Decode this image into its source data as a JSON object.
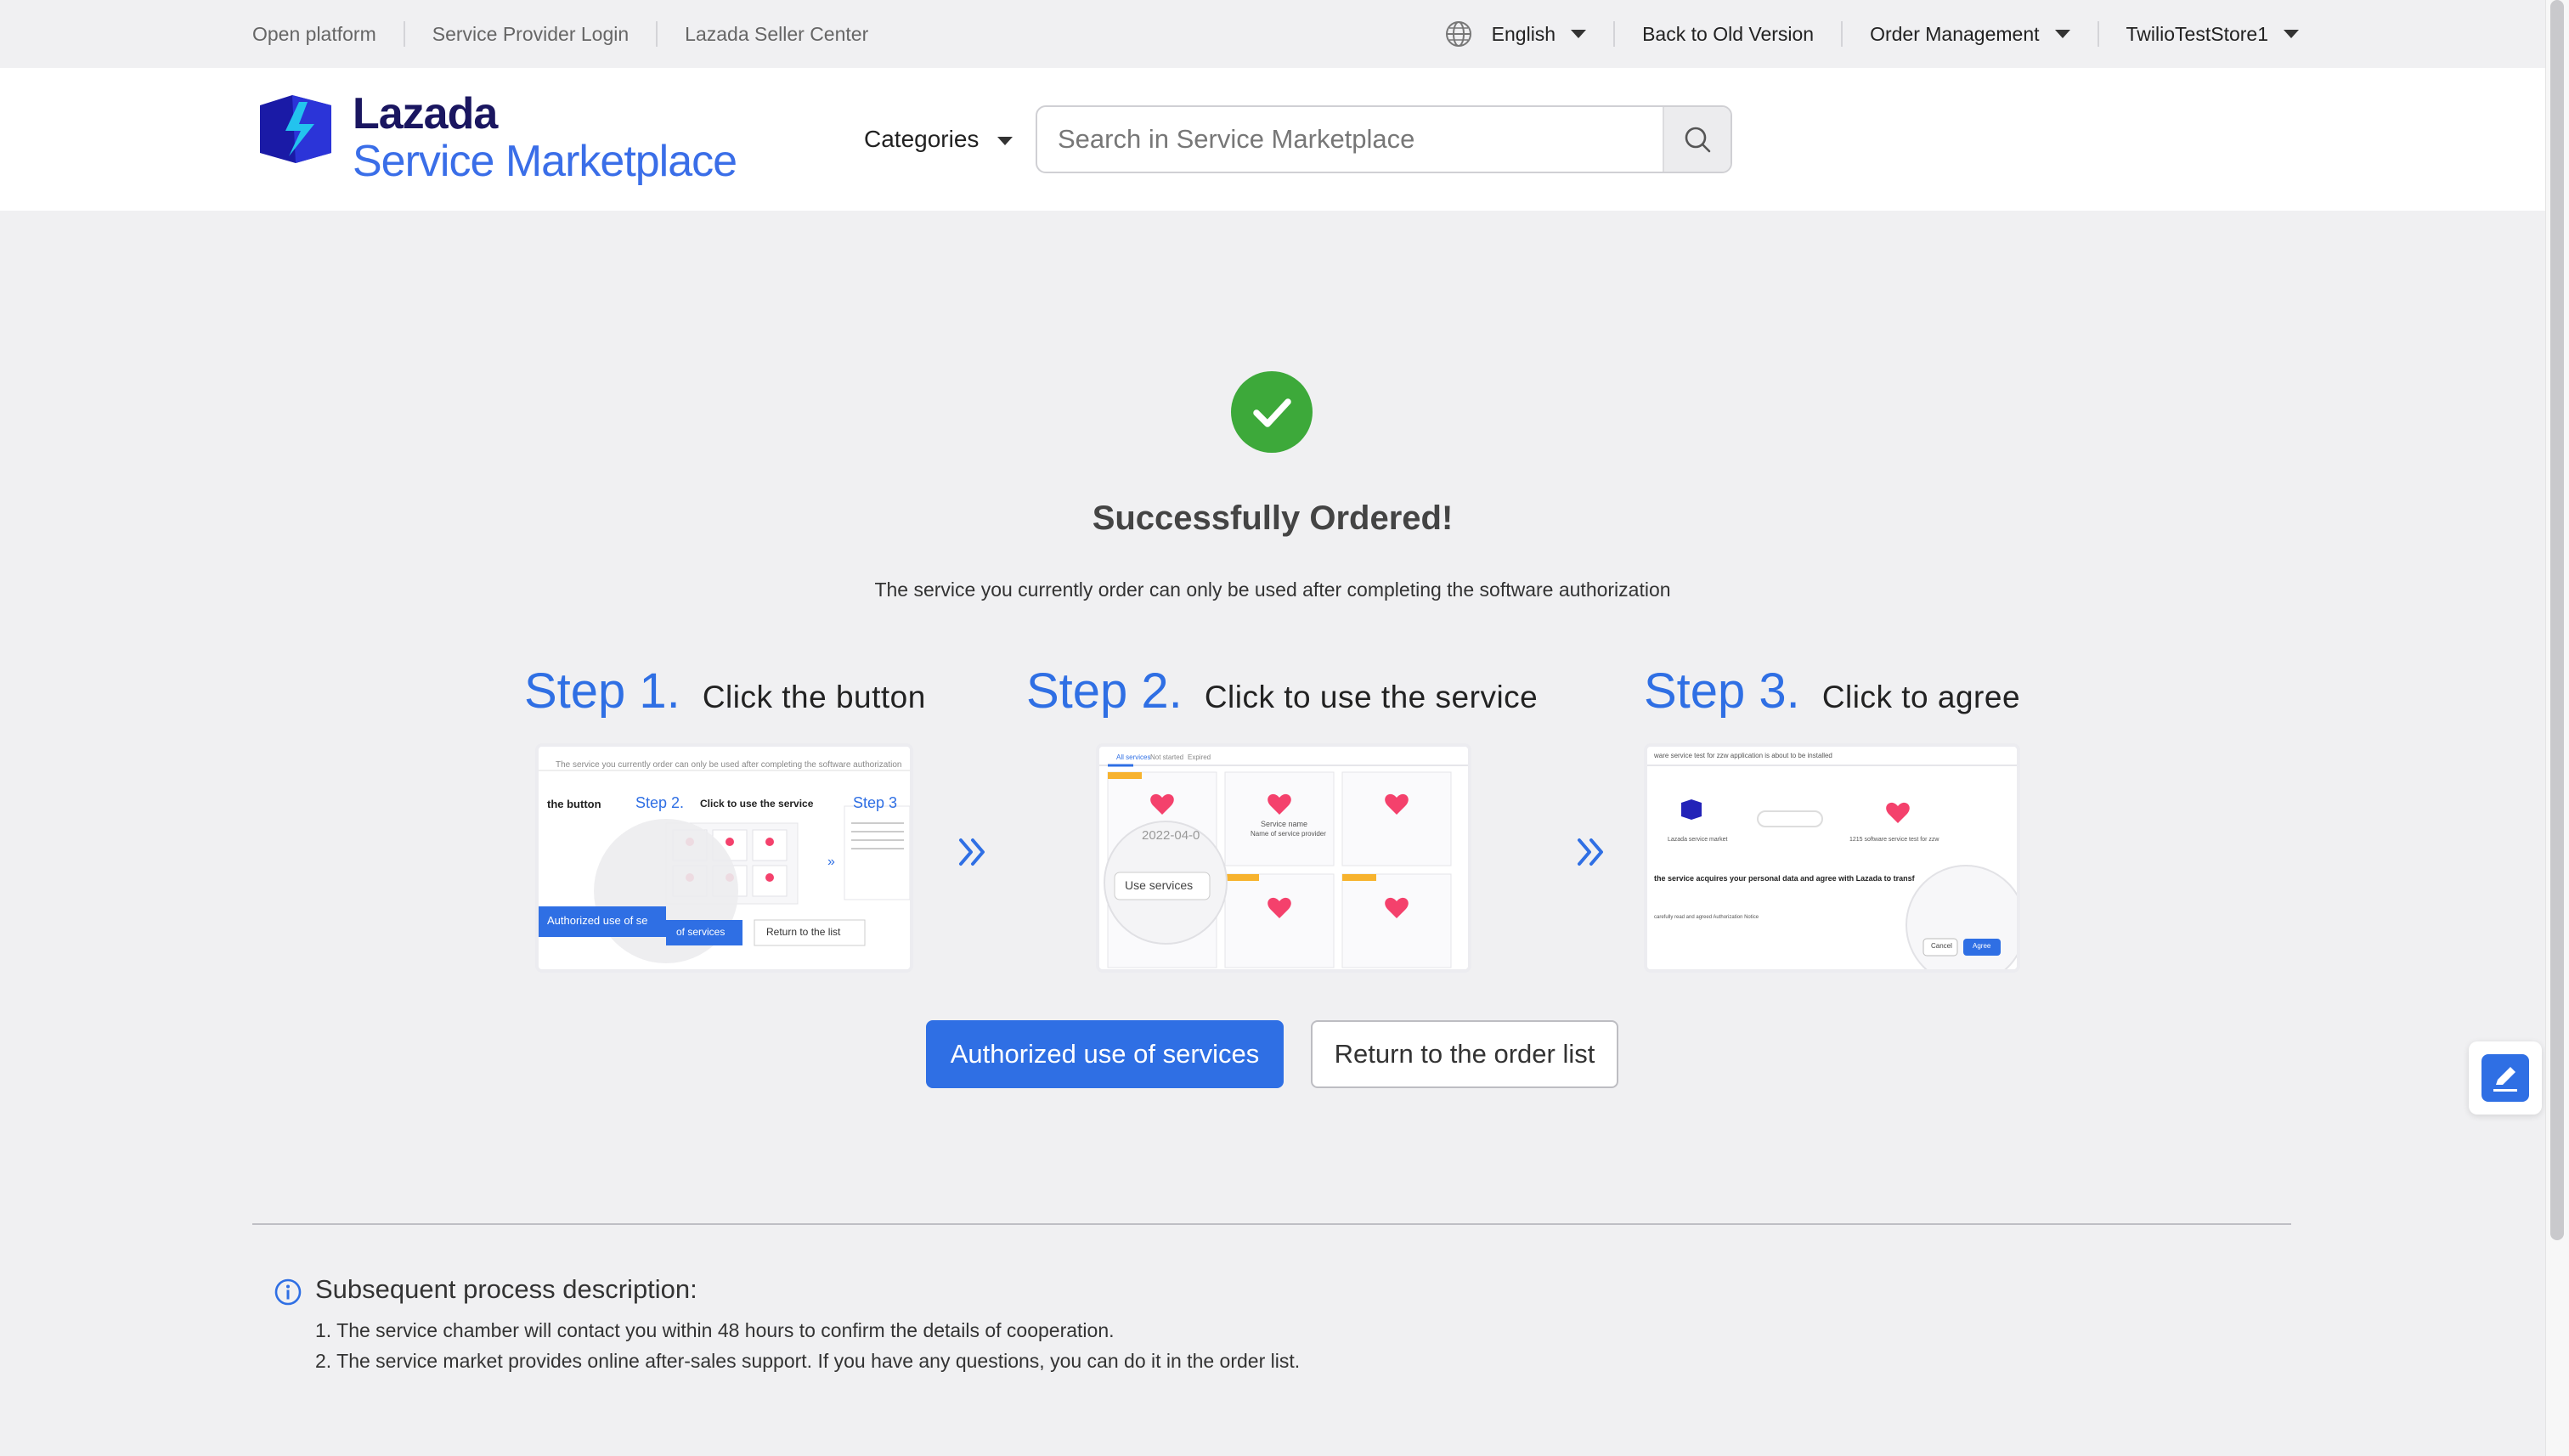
{
  "topbar": {
    "left_links": [
      "Open platform",
      "Service Provider Login",
      "Lazada Seller Center"
    ],
    "language": "English",
    "back_old": "Back to Old Version",
    "order_management": "Order Management",
    "account": "TwilioTestStore1"
  },
  "header": {
    "logo_line1": "Lazada",
    "logo_line2": "Service Marketplace",
    "categories": "Categories",
    "search_placeholder": "Search in Service Marketplace"
  },
  "main": {
    "title": "Successfully Ordered!",
    "subtitle": "The service you currently order can only be used after completing the software authorization",
    "steps": [
      {
        "num": "Step 1.",
        "desc": "Click the button"
      },
      {
        "num": "Step 2.",
        "desc": "Click to use the service"
      },
      {
        "num": "Step 3.",
        "desc": "Click to agree"
      }
    ],
    "shots": {
      "s1_top": "The service you currently order can only be used after completing the software authorization",
      "s1_button": "the button",
      "s1_step2": "Step 2.",
      "s1_step2_desc": "Click to use the service",
      "s1_step3": "Step 3",
      "s1_auth": "Authorized use of se",
      "s1_auth2": "of services",
      "s1_return": "Return to the list",
      "s2_tabs": [
        "All services",
        "Not started",
        "Expired"
      ],
      "s2_service_name": "Service name",
      "s2_provider": "Name of service provider",
      "s2_date": "2022-04-0",
      "s2_use": "Use services",
      "s3_top": "ware service test for zzw application is about to be installed",
      "s3_market": "Lazada service market",
      "s3_app": "1215 software service test for zzw",
      "s3_body": "the service acquires your personal data and agree with Lazada to transf",
      "s3_read": "carefully read and agreed Authorization Notice",
      "s3_cancel": "Cancel",
      "s3_agree": "Agree"
    },
    "btn_primary": "Authorized use of services",
    "btn_secondary": "Return to the order list"
  },
  "info": {
    "title": "Subsequent process description:",
    "lines": [
      "1. The service chamber will contact you within 48 hours to confirm the details of cooperation.",
      "2. The service market provides online after-sales support. If you have any questions, you can do it in the order list."
    ]
  },
  "colors": {
    "accent": "#2f6fe4",
    "success": "#3da93a",
    "logo_dark": "#1a1660"
  },
  "icons": [
    "globe-icon",
    "caret-down-icon",
    "search-icon",
    "check-icon",
    "double-chevron-right-icon",
    "info-icon",
    "edit-icon"
  ]
}
